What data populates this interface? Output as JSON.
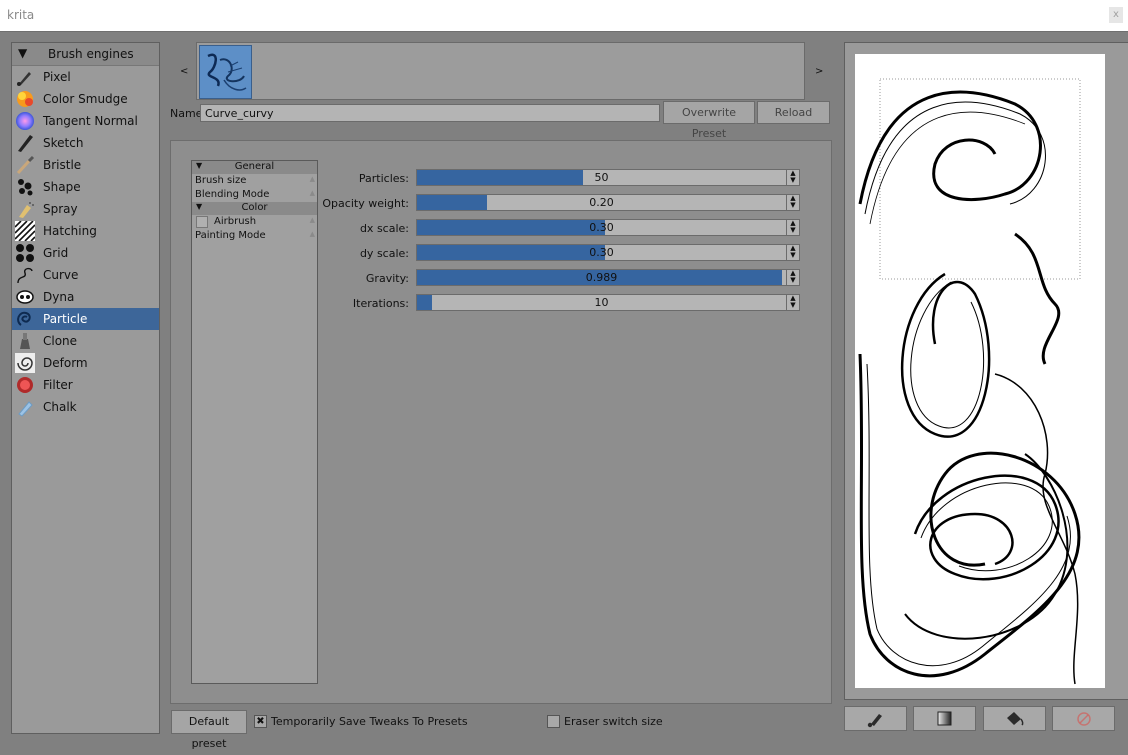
{
  "window": {
    "title": "krita",
    "close_glyph": "x"
  },
  "engines": {
    "header": "Brush engines",
    "items": [
      {
        "label": "Pixel",
        "icon": "pixel-brush-icon"
      },
      {
        "label": "Color Smudge",
        "icon": "color-smudge-icon"
      },
      {
        "label": "Tangent Normal",
        "icon": "tangent-normal-icon"
      },
      {
        "label": "Sketch",
        "icon": "sketch-icon"
      },
      {
        "label": "Bristle",
        "icon": "bristle-icon"
      },
      {
        "label": "Shape",
        "icon": "shape-icon"
      },
      {
        "label": "Spray",
        "icon": "spray-icon"
      },
      {
        "label": "Hatching",
        "icon": "hatching-icon"
      },
      {
        "label": "Grid",
        "icon": "grid-icon"
      },
      {
        "label": "Curve",
        "icon": "curve-icon"
      },
      {
        "label": "Dyna",
        "icon": "dyna-icon"
      },
      {
        "label": "Particle",
        "icon": "particle-icon",
        "selected": true
      },
      {
        "label": "Clone",
        "icon": "clone-icon"
      },
      {
        "label": "Deform",
        "icon": "deform-icon"
      },
      {
        "label": "Filter",
        "icon": "filter-icon"
      },
      {
        "label": "Chalk",
        "icon": "chalk-icon"
      }
    ]
  },
  "presets": {
    "prev": "<",
    "next": ">"
  },
  "name_row": {
    "label": "Name:",
    "value": "Curve_curvy",
    "overwrite": "Overwrite Preset",
    "reload": "Reload"
  },
  "options": {
    "general": "General",
    "brush_size": "Brush size",
    "blending_mode": "Blending Mode",
    "color": "Color",
    "airbrush": "Airbrush",
    "painting_mode": "Painting Mode"
  },
  "sliders": [
    {
      "label": "Particles:",
      "value": "50",
      "fraction": 0.45
    },
    {
      "label": "Opacity weight:",
      "value": "0.20",
      "fraction": 0.19
    },
    {
      "label": "dx scale:",
      "value": "0.30",
      "fraction": 0.51
    },
    {
      "label": "dy scale:",
      "value": "0.30",
      "fraction": 0.51
    },
    {
      "label": "Gravity:",
      "value": "0.989",
      "fraction": 0.989
    },
    {
      "label": "Iterations:",
      "value": "10",
      "fraction": 0.04
    }
  ],
  "bottom": {
    "default_preset": "Default preset",
    "temp_save": "Temporarily Save Tweaks To Presets",
    "temp_save_checked": true,
    "eraser_switch": "Eraser switch size",
    "eraser_switch_checked": false
  },
  "colors": {
    "accent": "#3665a0",
    "selected_row": "#3d6699",
    "panel": "#808080"
  }
}
